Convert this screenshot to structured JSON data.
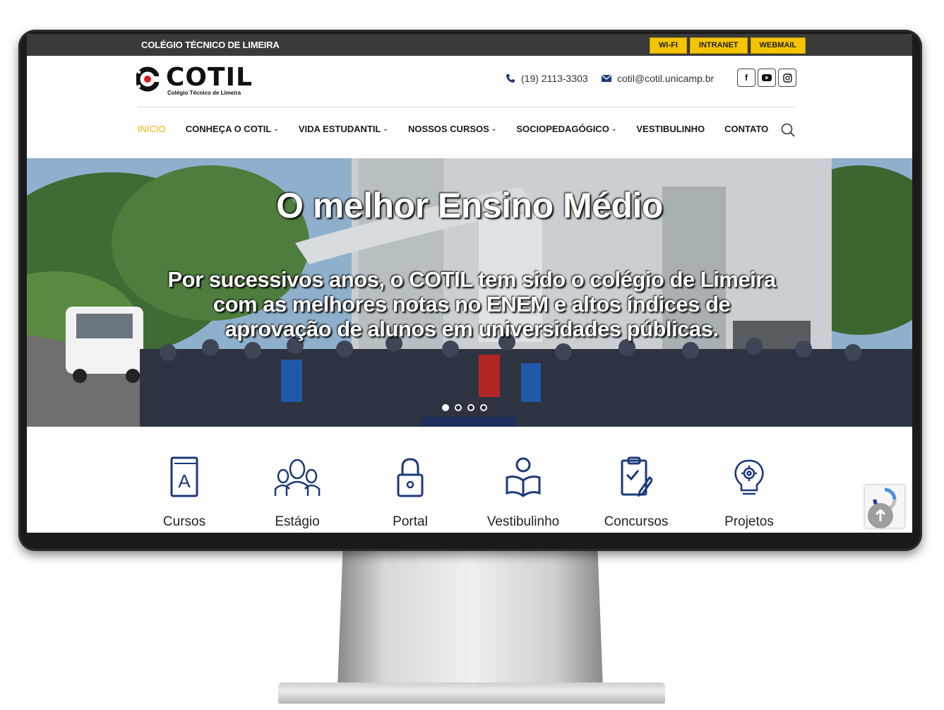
{
  "topbar": {
    "school_name": "COLÉGIO TÉCNICO DE LIMEIRA",
    "links": [
      "WI-FI",
      "INTRANET",
      "WEBMAIL"
    ]
  },
  "header": {
    "logo_text": "COTIL",
    "logo_subtitle": "Colégio Técnico de Limeira",
    "phone": "(19) 2113-3303",
    "email": "cotil@cotil.unicamp.br",
    "social": [
      "facebook-icon",
      "youtube-icon",
      "instagram-icon"
    ]
  },
  "nav": {
    "items": [
      {
        "label": "INÍCIO",
        "active": true,
        "dropdown": false
      },
      {
        "label": "CONHEÇA O COTIL",
        "active": false,
        "dropdown": true
      },
      {
        "label": "VIDA ESTUDANTIL",
        "active": false,
        "dropdown": true
      },
      {
        "label": "NOSSOS CURSOS",
        "active": false,
        "dropdown": true
      },
      {
        "label": "SOCIOPEDAGÓGICO",
        "active": false,
        "dropdown": true
      },
      {
        "label": "VESTIBULINHO",
        "active": false,
        "dropdown": false
      },
      {
        "label": "CONTATO",
        "active": false,
        "dropdown": false
      }
    ],
    "dropdown_glyph": "⌄"
  },
  "hero": {
    "title": "O melhor Ensino Médio",
    "subtitle": "Por sucessivos anos, o COTIL tem sido o colégio de Limeira com as melhores notas no ENEM e altos índices de aprovação de alunos em universidades públicas.",
    "slides": 4,
    "active_slide": 1
  },
  "quick_links": [
    {
      "label": "Cursos",
      "icon": "book-icon"
    },
    {
      "label": "Estágio",
      "icon": "people-icon"
    },
    {
      "label": "Portal",
      "icon": "padlock-icon"
    },
    {
      "label": "Vestibulinho",
      "icon": "reader-icon"
    },
    {
      "label": "Concursos",
      "icon": "clipboard-icon"
    },
    {
      "label": "Projetos",
      "icon": "lightbulb-gear-icon"
    }
  ],
  "colors": {
    "accent": "#f0b400",
    "topbar": "#3a3a3a",
    "icon_blue": "#1b3a7a",
    "top_link_bg": "#f5c400"
  }
}
